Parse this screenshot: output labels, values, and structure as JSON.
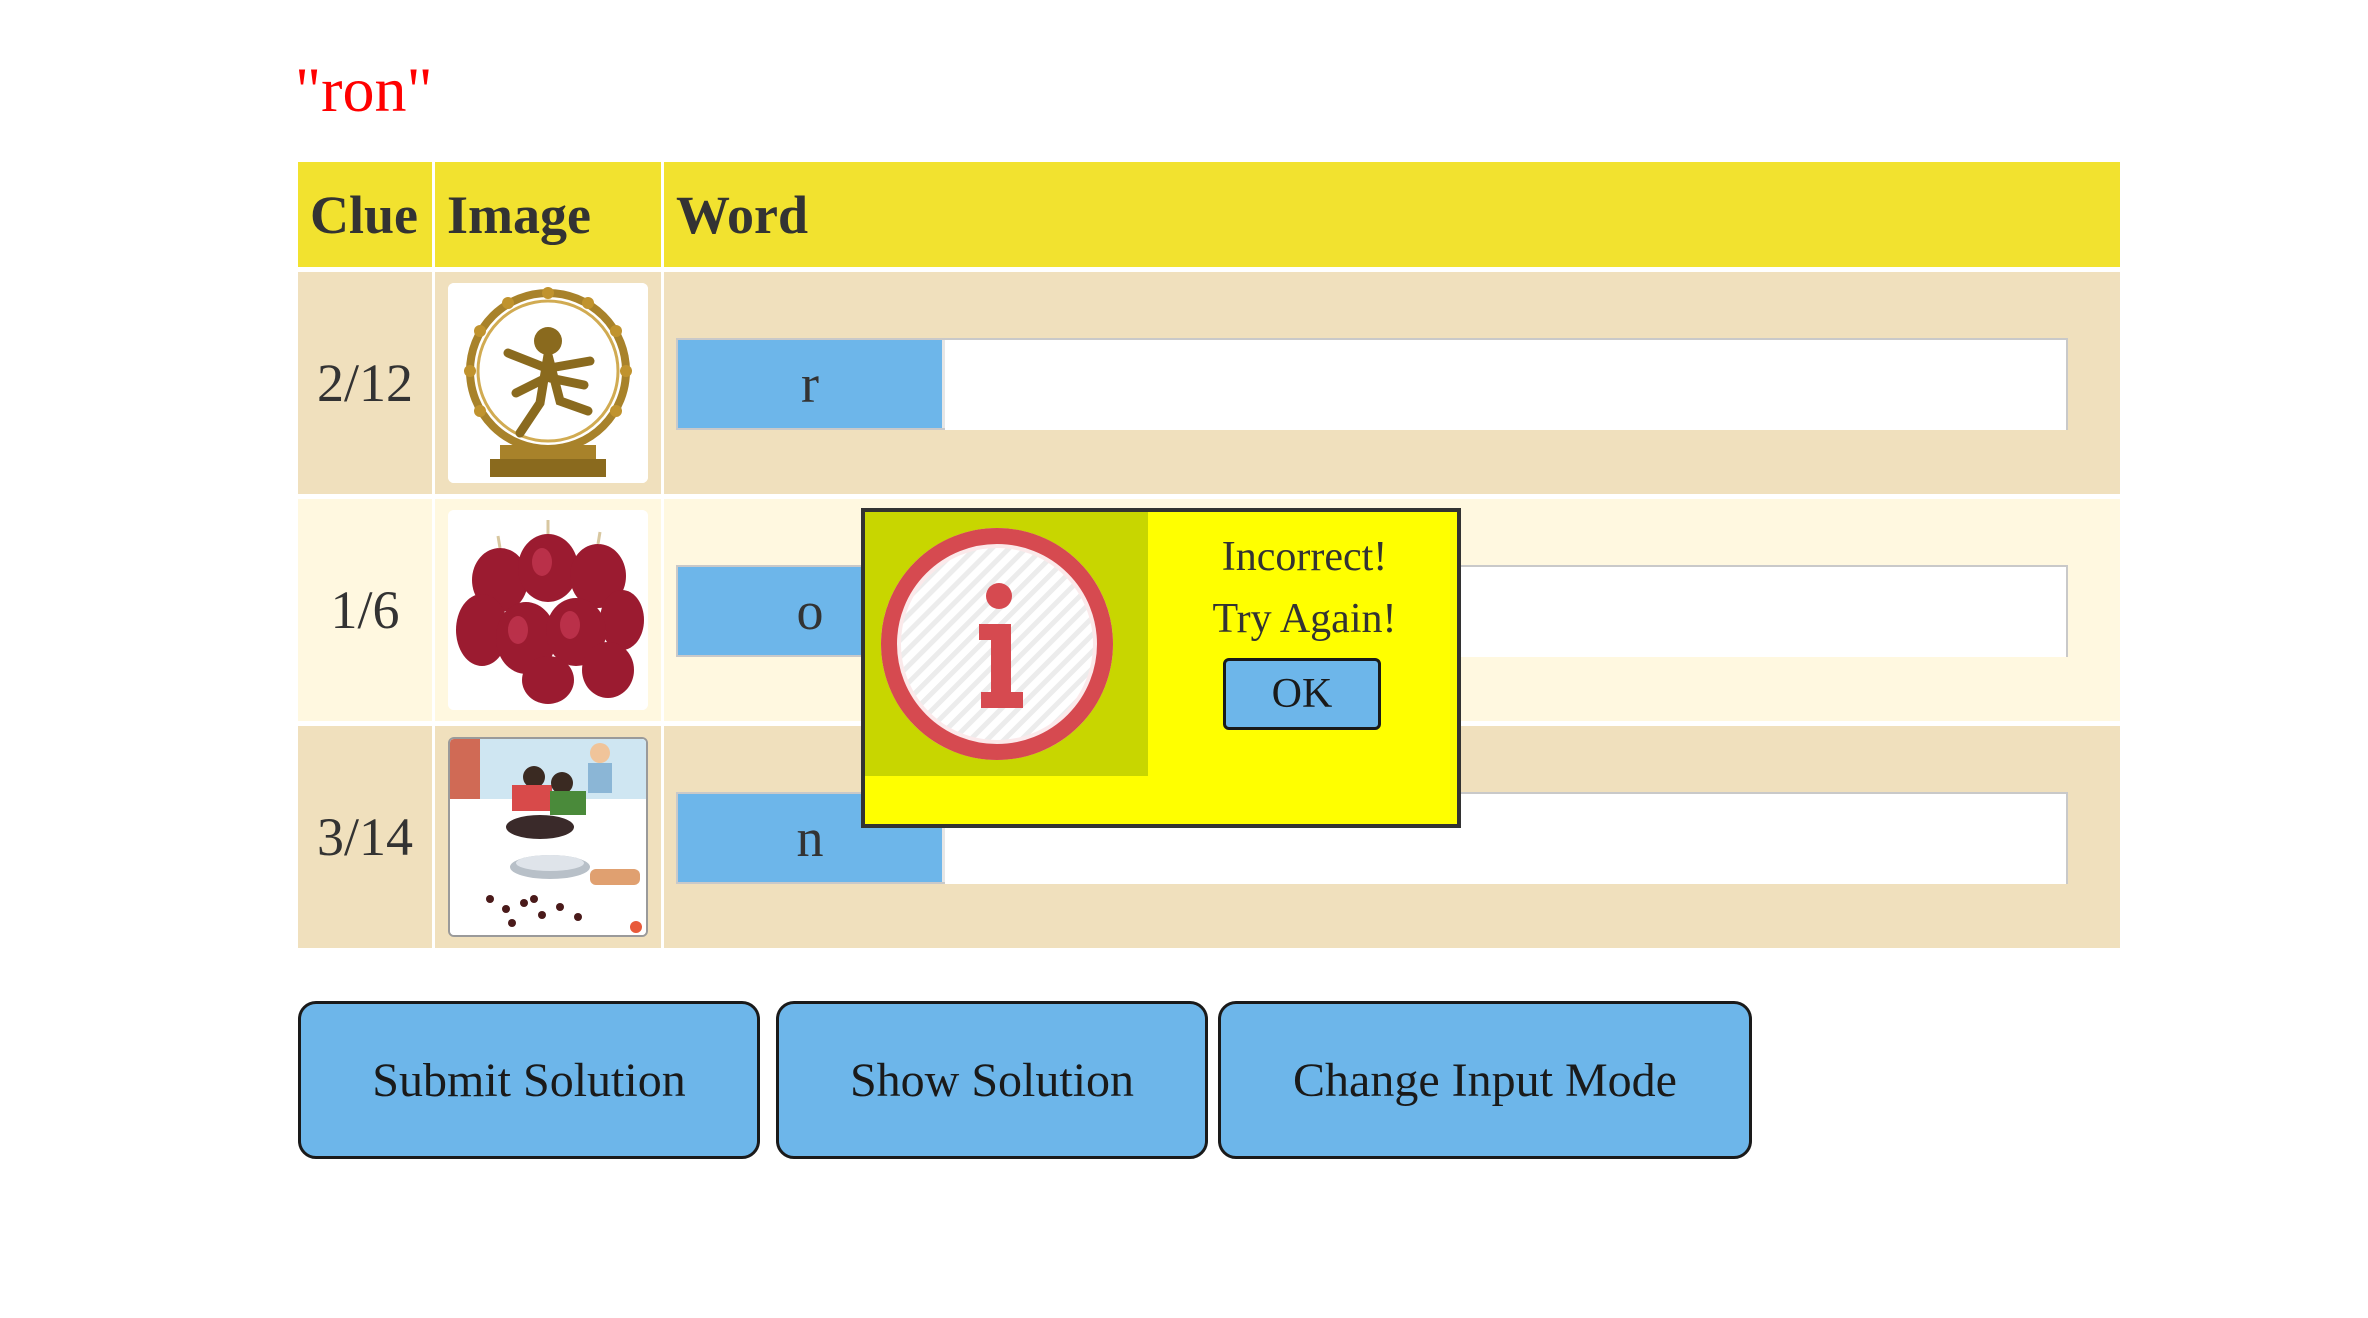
{
  "heading": "\"ron\"",
  "table": {
    "headers": {
      "clue": "Clue",
      "image": "Image",
      "word": "Word"
    },
    "rows": [
      {
        "clue": "2/12",
        "image": "nataraja-statue-image",
        "letter": "r",
        "bg": "#f0e0bd"
      },
      {
        "clue": "1/6",
        "image": "red-onions-image",
        "letter": "o",
        "bg": "#fff8e0"
      },
      {
        "clue": "3/14",
        "image": "people-cooking-illustration",
        "letter": "n",
        "bg": "#f0e0bd"
      }
    ]
  },
  "buttons": {
    "submit": "Submit Solution",
    "show": "Show Solution",
    "change_mode": "Change Input Mode"
  },
  "dialog": {
    "line1": "Incorrect!",
    "line2": "Try Again!",
    "ok": "OK",
    "icon": "info-icon"
  },
  "colors": {
    "heading": "#ff0000",
    "header_bg": "#f2e22f",
    "button_bg": "#6db6ea",
    "dialog_bg": "#ffff00",
    "dialog_icon_bg": "#c8d600"
  }
}
